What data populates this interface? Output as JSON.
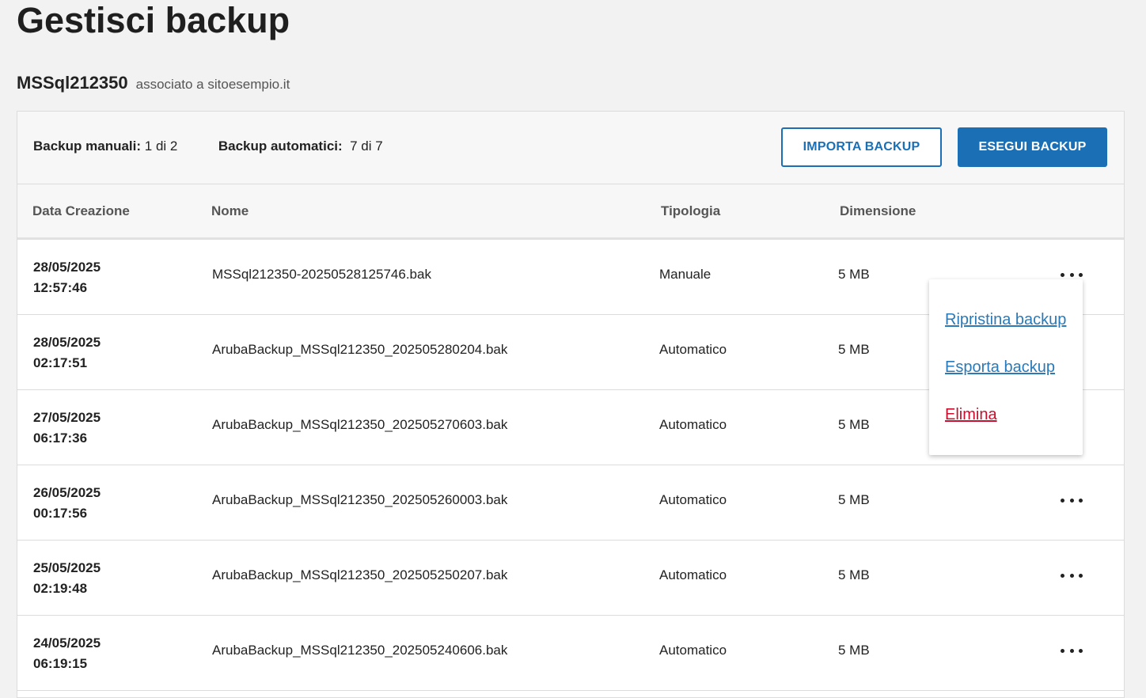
{
  "page": {
    "title": "Gestisci backup",
    "db_name": "MSSql212350",
    "associated_text": "associato a",
    "site": "sitoesempio.it"
  },
  "counters": {
    "manual_label": "Backup manuali:",
    "manual_value": "1 di 2",
    "auto_label": "Backup automatici:",
    "auto_value": "7 di 7"
  },
  "buttons": {
    "import": "IMPORTA BACKUP",
    "run": "ESEGUI BACKUP"
  },
  "table": {
    "headers": [
      "Data Creazione",
      "Nome",
      "Tipologia",
      "Dimensione"
    ],
    "rows": [
      {
        "date": "28/05/2025",
        "time": "12:57:46",
        "name": "MSSql212350-20250528125746.bak",
        "type": "Manuale",
        "size": "5 MB"
      },
      {
        "date": "28/05/2025",
        "time": "02:17:51",
        "name": "ArubaBackup_MSSql212350_202505280204.bak",
        "type": "Automatico",
        "size": "5 MB"
      },
      {
        "date": "27/05/2025",
        "time": "06:17:36",
        "name": "ArubaBackup_MSSql212350_202505270603.bak",
        "type": "Automatico",
        "size": "5 MB"
      },
      {
        "date": "26/05/2025",
        "time": "00:17:56",
        "name": "ArubaBackup_MSSql212350_202505260003.bak",
        "type": "Automatico",
        "size": "5 MB"
      },
      {
        "date": "25/05/2025",
        "time": "02:19:48",
        "name": "ArubaBackup_MSSql212350_202505250207.bak",
        "type": "Automatico",
        "size": "5 MB"
      },
      {
        "date": "24/05/2025",
        "time": "06:19:15",
        "name": "ArubaBackup_MSSql212350_202505240606.bak",
        "type": "Automatico",
        "size": "5 MB"
      }
    ]
  },
  "context_menu": {
    "restore": "Ripristina backup",
    "export": "Esporta backup",
    "delete": "Elimina"
  },
  "colors": {
    "accent": "#1a6fb5",
    "link": "#2a7ab9",
    "danger": "#c8102e",
    "background": "#f2f2f2"
  }
}
